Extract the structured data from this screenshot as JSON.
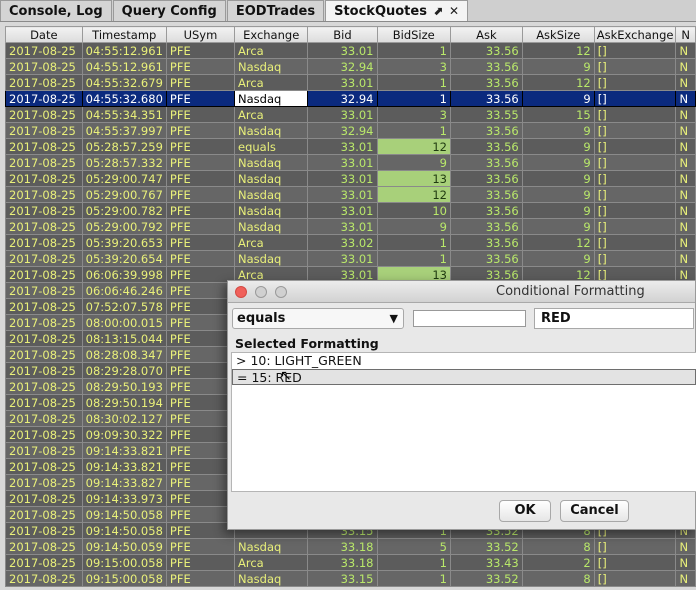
{
  "tabs": [
    {
      "label": "Console, Log"
    },
    {
      "label": "Query Config"
    },
    {
      "label": "EODTrades"
    },
    {
      "label": "StockQuotes",
      "active": true,
      "pin_glyph": "⬈",
      "close_glyph": "✕"
    }
  ],
  "table": {
    "columns": [
      "Date",
      "Timestamp",
      "USym",
      "Exchange",
      "Bid",
      "BidSize",
      "Ask",
      "AskSize",
      "AskExchange",
      "N"
    ],
    "rows": [
      {
        "date": "2017-08-25",
        "ts": "04:55:12.961",
        "sym": "PFE",
        "exch": "Arca",
        "bid": "33.01",
        "bidsize": "1",
        "ask": "33.56",
        "asksize": "12",
        "askexch": "[]",
        "n": "N"
      },
      {
        "date": "2017-08-25",
        "ts": "04:55:12.961",
        "sym": "PFE",
        "exch": "Nasdaq",
        "bid": "32.94",
        "bidsize": "3",
        "ask": "33.56",
        "asksize": "9",
        "askexch": "[]",
        "n": "N"
      },
      {
        "date": "2017-08-25",
        "ts": "04:55:32.679",
        "sym": "PFE",
        "exch": "Arca",
        "bid": "33.01",
        "bidsize": "1",
        "ask": "33.56",
        "asksize": "12",
        "askexch": "[]",
        "n": "N"
      },
      {
        "date": "2017-08-25",
        "ts": "04:55:32.680",
        "sym": "PFE",
        "exch": "Nasdaq",
        "bid": "32.94",
        "bidsize": "1",
        "ask": "33.56",
        "asksize": "9",
        "askexch": "[]",
        "n": "N",
        "selected": true
      },
      {
        "date": "2017-08-25",
        "ts": "04:55:34.351",
        "sym": "PFE",
        "exch": "Arca",
        "bid": "33.01",
        "bidsize": "3",
        "ask": "33.55",
        "asksize": "15",
        "askexch": "[]",
        "n": "N"
      },
      {
        "date": "2017-08-25",
        "ts": "04:55:37.997",
        "sym": "PFE",
        "exch": "Nasdaq",
        "bid": "32.94",
        "bidsize": "1",
        "ask": "33.56",
        "asksize": "9",
        "askexch": "[]",
        "n": "N"
      },
      {
        "date": "2017-08-25",
        "ts": "05:28:57.259",
        "sym": "PFE",
        "exch": "equals",
        "bid": "33.01",
        "bidsize": "12",
        "ask": "33.56",
        "asksize": "9",
        "askexch": "[]",
        "n": "N",
        "hl": true
      },
      {
        "date": "2017-08-25",
        "ts": "05:28:57.332",
        "sym": "PFE",
        "exch": "Nasdaq",
        "bid": "33.01",
        "bidsize": "9",
        "ask": "33.56",
        "asksize": "9",
        "askexch": "[]",
        "n": "N"
      },
      {
        "date": "2017-08-25",
        "ts": "05:29:00.747",
        "sym": "PFE",
        "exch": "Nasdaq",
        "bid": "33.01",
        "bidsize": "13",
        "ask": "33.56",
        "asksize": "9",
        "askexch": "[]",
        "n": "N",
        "hl": true
      },
      {
        "date": "2017-08-25",
        "ts": "05:29:00.767",
        "sym": "PFE",
        "exch": "Nasdaq",
        "bid": "33.01",
        "bidsize": "12",
        "ask": "33.56",
        "asksize": "9",
        "askexch": "[]",
        "n": "N",
        "hl": true
      },
      {
        "date": "2017-08-25",
        "ts": "05:29:00.782",
        "sym": "PFE",
        "exch": "Nasdaq",
        "bid": "33.01",
        "bidsize": "10",
        "ask": "33.56",
        "asksize": "9",
        "askexch": "[]",
        "n": "N"
      },
      {
        "date": "2017-08-25",
        "ts": "05:29:00.792",
        "sym": "PFE",
        "exch": "Nasdaq",
        "bid": "33.01",
        "bidsize": "9",
        "ask": "33.56",
        "asksize": "9",
        "askexch": "[]",
        "n": "N"
      },
      {
        "date": "2017-08-25",
        "ts": "05:39:20.653",
        "sym": "PFE",
        "exch": "Arca",
        "bid": "33.02",
        "bidsize": "1",
        "ask": "33.56",
        "asksize": "12",
        "askexch": "[]",
        "n": "N"
      },
      {
        "date": "2017-08-25",
        "ts": "05:39:20.654",
        "sym": "PFE",
        "exch": "Nasdaq",
        "bid": "33.01",
        "bidsize": "1",
        "ask": "33.56",
        "asksize": "9",
        "askexch": "[]",
        "n": "N"
      },
      {
        "date": "2017-08-25",
        "ts": "06:06:39.998",
        "sym": "PFE",
        "exch": "Arca",
        "bid": "33.01",
        "bidsize": "13",
        "ask": "33.56",
        "asksize": "12",
        "askexch": "[]",
        "n": "N",
        "hl": true
      },
      {
        "date": "2017-08-25",
        "ts": "06:06:46.246",
        "sym": "PFE",
        "exch": "",
        "bid": "",
        "bidsize": "",
        "ask": "",
        "asksize": "",
        "askexch": "",
        "n": ""
      },
      {
        "date": "2017-08-25",
        "ts": "07:52:07.578",
        "sym": "PFE",
        "exch": "",
        "bid": "",
        "bidsize": "",
        "ask": "",
        "asksize": "",
        "askexch": "",
        "n": ""
      },
      {
        "date": "2017-08-25",
        "ts": "08:00:00.015",
        "sym": "PFE",
        "exch": "",
        "bid": "",
        "bidsize": "",
        "ask": "",
        "asksize": "",
        "askexch": "",
        "n": ""
      },
      {
        "date": "2017-08-25",
        "ts": "08:13:15.044",
        "sym": "PFE",
        "exch": "",
        "bid": "",
        "bidsize": "",
        "ask": "",
        "asksize": "",
        "askexch": "",
        "n": ""
      },
      {
        "date": "2017-08-25",
        "ts": "08:28:08.347",
        "sym": "PFE",
        "exch": "",
        "bid": "",
        "bidsize": "",
        "ask": "",
        "asksize": "",
        "askexch": "",
        "n": ""
      },
      {
        "date": "2017-08-25",
        "ts": "08:29:28.070",
        "sym": "PFE",
        "exch": "",
        "bid": "",
        "bidsize": "",
        "ask": "",
        "asksize": "",
        "askexch": "",
        "n": ""
      },
      {
        "date": "2017-08-25",
        "ts": "08:29:50.193",
        "sym": "PFE",
        "exch": "",
        "bid": "",
        "bidsize": "",
        "ask": "",
        "asksize": "",
        "askexch": "",
        "n": ""
      },
      {
        "date": "2017-08-25",
        "ts": "08:29:50.194",
        "sym": "PFE",
        "exch": "",
        "bid": "",
        "bidsize": "",
        "ask": "",
        "asksize": "",
        "askexch": "",
        "n": ""
      },
      {
        "date": "2017-08-25",
        "ts": "08:30:02.127",
        "sym": "PFE",
        "exch": "",
        "bid": "",
        "bidsize": "",
        "ask": "",
        "asksize": "",
        "askexch": "",
        "n": ""
      },
      {
        "date": "2017-08-25",
        "ts": "09:09:30.322",
        "sym": "PFE",
        "exch": "",
        "bid": "",
        "bidsize": "",
        "ask": "",
        "asksize": "",
        "askexch": "",
        "n": ""
      },
      {
        "date": "2017-08-25",
        "ts": "09:14:33.821",
        "sym": "PFE",
        "exch": "",
        "bid": "",
        "bidsize": "",
        "ask": "",
        "asksize": "",
        "askexch": "",
        "n": ""
      },
      {
        "date": "2017-08-25",
        "ts": "09:14:33.821",
        "sym": "PFE",
        "exch": "",
        "bid": "",
        "bidsize": "",
        "ask": "",
        "asksize": "",
        "askexch": "",
        "n": ""
      },
      {
        "date": "2017-08-25",
        "ts": "09:14:33.827",
        "sym": "PFE",
        "exch": "",
        "bid": "",
        "bidsize": "",
        "ask": "",
        "asksize": "",
        "askexch": "",
        "n": ""
      },
      {
        "date": "2017-08-25",
        "ts": "09:14:33.973",
        "sym": "PFE",
        "exch": "",
        "bid": "",
        "bidsize": "",
        "ask": "",
        "asksize": "",
        "askexch": "",
        "n": ""
      },
      {
        "date": "2017-08-25",
        "ts": "09:14:50.058",
        "sym": "PFE",
        "exch": "",
        "bid": "",
        "bidsize": "",
        "ask": "",
        "asksize": "",
        "askexch": "",
        "n": ""
      },
      {
        "date": "2017-08-25",
        "ts": "09:14:50.058",
        "sym": "PFE",
        "exch": "",
        "bid": "33.15",
        "bidsize": "1",
        "ask": "33.52",
        "asksize": "8",
        "askexch": "[]",
        "n": "N"
      },
      {
        "date": "2017-08-25",
        "ts": "09:14:50.059",
        "sym": "PFE",
        "exch": "Nasdaq",
        "bid": "33.18",
        "bidsize": "5",
        "ask": "33.52",
        "asksize": "8",
        "askexch": "[]",
        "n": "N"
      },
      {
        "date": "2017-08-25",
        "ts": "09:15:00.058",
        "sym": "PFE",
        "exch": "Arca",
        "bid": "33.18",
        "bidsize": "1",
        "ask": "33.43",
        "asksize": "2",
        "askexch": "[]",
        "n": "N"
      },
      {
        "date": "2017-08-25",
        "ts": "09:15:00.058",
        "sym": "PFE",
        "exch": "Nasdaq",
        "bid": "33.15",
        "bidsize": "1",
        "ask": "33.52",
        "asksize": "8",
        "askexch": "[]",
        "n": "N"
      }
    ]
  },
  "dialog": {
    "title": "Conditional Formatting",
    "operator": "equals",
    "operator_arrow": "▼",
    "value_placeholder": "",
    "color": "RED",
    "selected_label": "Selected Formatting",
    "items": [
      {
        "label": "> 10: LIGHT_GREEN",
        "selected": false
      },
      {
        "label": "= 15: RED",
        "selected": true
      }
    ],
    "ok_label": "OK",
    "cancel_label": "Cancel"
  },
  "colors": {
    "highlight_green": "#a8d07a",
    "selected_row": "#0b2a7e",
    "cell_text": "#e9f07a",
    "numeric_text": "#b9e86a",
    "close_light": "#f0605a"
  }
}
